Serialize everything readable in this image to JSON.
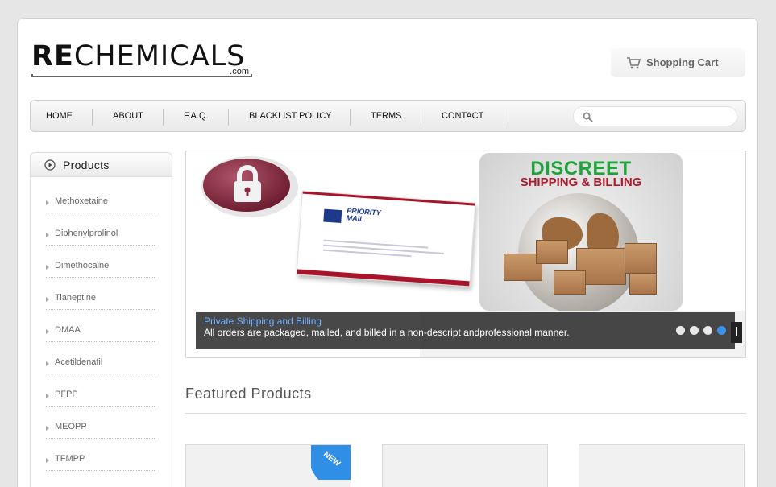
{
  "brand": {
    "logo_bold": "RE",
    "logo_rest": "CHEMICALS",
    "logo_suffix": ".com"
  },
  "header": {
    "cart_label": "Shopping Cart",
    "cart_icon": "cart-icon"
  },
  "nav": {
    "items": [
      {
        "label": "HOME"
      },
      {
        "label": "ABOUT"
      },
      {
        "label": "F.A.Q."
      },
      {
        "label": "BLACKLIST POLICY"
      },
      {
        "label": "TERMS"
      },
      {
        "label": "CONTACT"
      }
    ],
    "search": {
      "placeholder": "",
      "value": "",
      "icon": "search-icon"
    }
  },
  "sidebar": {
    "title": "Products",
    "icon": "play-circle-icon",
    "items": [
      {
        "label": "Methoxetaine"
      },
      {
        "label": "Diphenylprolinol"
      },
      {
        "label": "Dimethocaine"
      },
      {
        "label": "Tianeptine"
      },
      {
        "label": "DMAA"
      },
      {
        "label": "Acetildenafil"
      },
      {
        "label": "PFPP"
      },
      {
        "label": "MEOPP"
      },
      {
        "label": "TFMPP"
      }
    ]
  },
  "banner": {
    "envelope_title_1": "PRIORITY",
    "envelope_title_2": "MAIL",
    "graphic_title_1": "DISCREET",
    "graphic_title_2": "SHIPPING & BILLING",
    "caption_title": "Private Shipping and Billing",
    "caption_text": "All orders are packaged, mailed, and billed in a non-descript andprofessional manner.",
    "slides_total": 4,
    "active_slide": 4
  },
  "featured": {
    "title": "Featured Products",
    "badge": "NEW"
  },
  "colors": {
    "accent_blue": "#3b92e8",
    "caption_link": "#6fb0ff",
    "discreet_green": "#1fa33a",
    "discreet_red": "#b0182c"
  }
}
